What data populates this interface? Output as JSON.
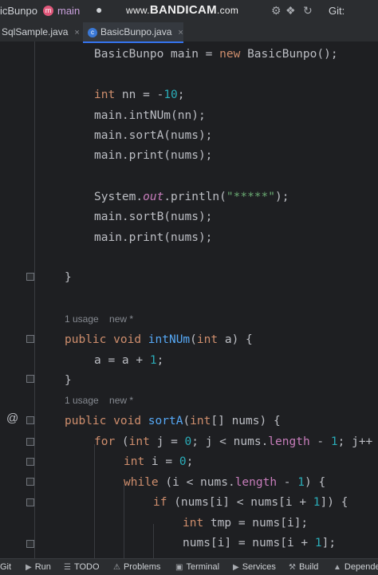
{
  "topbar": {
    "project": "icBunpo",
    "module_icon": "m",
    "branch": "main",
    "watermark_prefix": "www.",
    "watermark": "BANDICAM",
    "watermark_suffix": ".com",
    "git_label": "Git:"
  },
  "tabs": [
    {
      "label": "SqlSample.java",
      "close": "×"
    },
    {
      "label": "BasicBunpo.java",
      "close": "×",
      "icon": "c",
      "active": true
    }
  ],
  "code": [
    "BasicBunpo main = new BasicBunpo();",
    "int nn = -10;",
    "main.intNUm(nn);",
    "main.sortA(nums);",
    "main.print(nums);",
    "System.out.println(\"*****\");",
    "main.sortB(nums);",
    "main.print(nums);",
    "}",
    "public void intNUm(int a) {",
    "a = a + 1;",
    "}",
    "public void sortA(int[] nums) {",
    "for (int j = 0; j < nums.length - 1; j++",
    "int i = 0;",
    "while (i < nums.length - 1) {",
    "if (nums[i] < nums[i + 1]) {",
    "int tmp = nums[i];",
    "nums[i] = nums[i + 1];"
  ],
  "hints": {
    "usage1": "1 usage",
    "new1": "new *",
    "usage2": "1 usage",
    "new2": "new *"
  },
  "gutter": {
    "implements_marker": "@"
  },
  "statusbar": {
    "git": "Git",
    "run": "Run",
    "todo": "TODO",
    "problems": "Problems",
    "terminal": "Terminal",
    "services": "Services",
    "build": "Build",
    "dependencies": "Depende"
  },
  "colors": {
    "background": "#1e1f22",
    "keyword": "#cf8e6d",
    "function": "#56a8f5",
    "number": "#2aacb8",
    "string": "#6aab73",
    "field": "#c77dbb",
    "text": "#bcbec4"
  },
  "icons": [
    "user-icon",
    "settings-icon",
    "git-icon",
    "java-class-icon",
    "fold-icon",
    "implements-icon",
    "run-icon",
    "todo-icon",
    "problems-icon",
    "terminal-icon",
    "services-icon",
    "build-icon"
  ]
}
